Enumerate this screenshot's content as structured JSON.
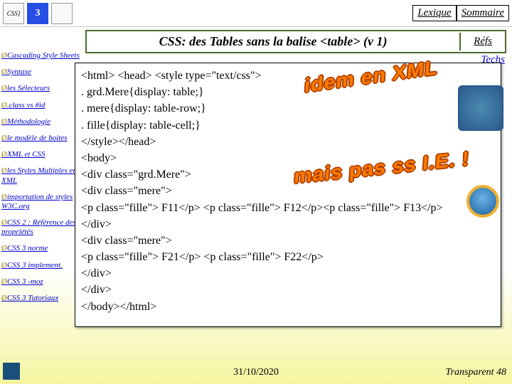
{
  "top": {
    "logo_label": "CSS}",
    "lexique": "Lexique",
    "sommaire": "Sommaire"
  },
  "title": "CSS: des Tables sans la balise <table> (v 1)",
  "refs": "Réfs",
  "techs": "Techs",
  "sidebar": [
    "Cascading Style Sheets",
    "Syntaxe",
    "les Sélecteurs",
    ".class vs #id",
    "Méthodologie",
    "le modèle de boites",
    "XML et CSS",
    "les Styles Multiples en XML",
    "importation de styles W3C.org",
    "CSS 2 : Référence des propriétés",
    "CSS 3 norme",
    "CSS 3 implement.",
    "CSS 3 -moz",
    "CSS 3 Tutoriaux"
  ],
  "code": "<html> <head> <style type=\"text/css\">\n. grd.Mere{display: table;}\n. mere{display: table-row;}\n. fille{display: table-cell;}\n</style></head>\n<body>\n<div class=\"grd.Mere\">\n<div class=\"mere\">\n<p class=\"fille\"> F11</p> <p class=\"fille\"> F12</p><p class=\"fille\"> F13</p>\n</div>\n<div class=\"mere\">\n<p class=\"fille\"> F21</p> <p class=\"fille\"> F22</p>\n</div>\n</div>\n</body></html>",
  "overlay1": "idem en XML",
  "overlay2": "mais pas ss I.E. !",
  "footer": {
    "date": "31/10/2020",
    "page": "Transparent 48"
  }
}
